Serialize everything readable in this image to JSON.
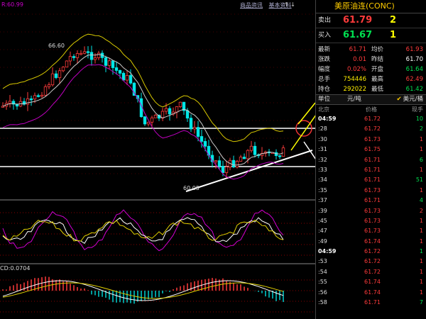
{
  "chart": {
    "top_left": "R:60.99",
    "links": [
      "商品资讯",
      "基本资料"
    ],
    "icons": "↑ ↓",
    "high_label": "66.60",
    "low_label": "60.05",
    "macd_label": "CD:0.0704"
  },
  "quote": {
    "title": "美原油连(CONC)",
    "sell_label": "卖出",
    "sell_price": "61.79",
    "sell_qty": "2",
    "buy_label": "买入",
    "buy_price": "61.67",
    "buy_qty": "1",
    "stats": [
      {
        "l1": "最新",
        "v1": "61.71",
        "c1": "red",
        "l2": "均价",
        "v2": "61.93",
        "c2": "red"
      },
      {
        "l1": "涨跌",
        "v1": "0.01",
        "c1": "red",
        "l2": "昨结",
        "v2": "61.70",
        "c2": "white"
      },
      {
        "l1": "幅度",
        "v1": "0.02%",
        "c1": "red",
        "l2": "开盘",
        "v2": "61.64",
        "c2": "green"
      },
      {
        "l1": "总手",
        "v1": "754446",
        "c1": "yellow",
        "l2": "最高",
        "v2": "62.49",
        "c2": "red"
      },
      {
        "l1": "持仓",
        "v1": "292022",
        "c1": "yellow",
        "l2": "最低",
        "v2": "61.42",
        "c2": "green"
      }
    ],
    "unit_left": "单位",
    "unit_mid": "元/吨",
    "unit_right": "美元/桶",
    "tick_headers": [
      "北京",
      "价格",
      "现手"
    ],
    "ticks": [
      {
        "t": "04:59",
        "p": "61.72",
        "v": "10",
        "vc": "green",
        "big": true
      },
      {
        "t": ":28",
        "p": "61.72",
        "v": "2",
        "vc": "green"
      },
      {
        "t": ":30",
        "p": "61.73",
        "v": "1",
        "vc": "red"
      },
      {
        "t": ":31",
        "p": "61.75",
        "v": "1",
        "vc": "red"
      },
      {
        "t": ":32",
        "p": "61.71",
        "v": "6",
        "vc": "green"
      },
      {
        "t": ":33",
        "p": "61.71",
        "v": "1",
        "vc": "red"
      },
      {
        "t": ":34",
        "p": "61.71",
        "v": "51",
        "vc": "green"
      },
      {
        "t": ":35",
        "p": "61.73",
        "v": "1",
        "vc": "red"
      },
      {
        "t": ":37",
        "p": "61.71",
        "v": "4",
        "vc": "green"
      },
      {
        "t": ":39",
        "p": "61.73",
        "v": "2",
        "vc": "red"
      },
      {
        "t": ":45",
        "p": "61.73",
        "v": "1",
        "vc": "red"
      },
      {
        "t": ":47",
        "p": "61.73",
        "v": "1",
        "vc": "red"
      },
      {
        "t": ":49",
        "p": "61.74",
        "v": "1",
        "vc": "red"
      },
      {
        "t": "04:59",
        "p": "61.72",
        "v": "1",
        "vc": "green",
        "big": true
      },
      {
        "t": ":53",
        "p": "61.72",
        "v": "1",
        "vc": "red"
      },
      {
        "t": ":54",
        "p": "61.72",
        "v": "1",
        "vc": "red"
      },
      {
        "t": ":55",
        "p": "61.74",
        "v": "1",
        "vc": "red"
      },
      {
        "t": ":56",
        "p": "61.74",
        "v": "1",
        "vc": "red"
      },
      {
        "t": ":58",
        "p": "61.71",
        "v": "7",
        "vc": "green"
      }
    ]
  },
  "colors": {
    "up": "#ff3b3b",
    "down": "#00e6e6",
    "upper_band": "#d8c800",
    "lower_band": "#c000c0",
    "mid": "#cccccc"
  }
}
